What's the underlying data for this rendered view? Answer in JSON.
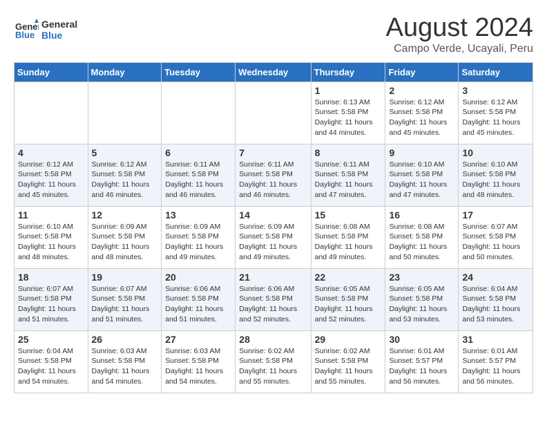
{
  "header": {
    "logo_line1": "General",
    "logo_line2": "Blue",
    "title": "August 2024",
    "subtitle": "Campo Verde, Ucayali, Peru"
  },
  "weekdays": [
    "Sunday",
    "Monday",
    "Tuesday",
    "Wednesday",
    "Thursday",
    "Friday",
    "Saturday"
  ],
  "weeks": [
    [
      {
        "day": "",
        "info": ""
      },
      {
        "day": "",
        "info": ""
      },
      {
        "day": "",
        "info": ""
      },
      {
        "day": "",
        "info": ""
      },
      {
        "day": "1",
        "info": "Sunrise: 6:13 AM\nSunset: 5:58 PM\nDaylight: 11 hours\nand 44 minutes."
      },
      {
        "day": "2",
        "info": "Sunrise: 6:12 AM\nSunset: 5:58 PM\nDaylight: 11 hours\nand 45 minutes."
      },
      {
        "day": "3",
        "info": "Sunrise: 6:12 AM\nSunset: 5:58 PM\nDaylight: 11 hours\nand 45 minutes."
      }
    ],
    [
      {
        "day": "4",
        "info": "Sunrise: 6:12 AM\nSunset: 5:58 PM\nDaylight: 11 hours\nand 45 minutes."
      },
      {
        "day": "5",
        "info": "Sunrise: 6:12 AM\nSunset: 5:58 PM\nDaylight: 11 hours\nand 46 minutes."
      },
      {
        "day": "6",
        "info": "Sunrise: 6:11 AM\nSunset: 5:58 PM\nDaylight: 11 hours\nand 46 minutes."
      },
      {
        "day": "7",
        "info": "Sunrise: 6:11 AM\nSunset: 5:58 PM\nDaylight: 11 hours\nand 46 minutes."
      },
      {
        "day": "8",
        "info": "Sunrise: 6:11 AM\nSunset: 5:58 PM\nDaylight: 11 hours\nand 47 minutes."
      },
      {
        "day": "9",
        "info": "Sunrise: 6:10 AM\nSunset: 5:58 PM\nDaylight: 11 hours\nand 47 minutes."
      },
      {
        "day": "10",
        "info": "Sunrise: 6:10 AM\nSunset: 5:58 PM\nDaylight: 11 hours\nand 48 minutes."
      }
    ],
    [
      {
        "day": "11",
        "info": "Sunrise: 6:10 AM\nSunset: 5:58 PM\nDaylight: 11 hours\nand 48 minutes."
      },
      {
        "day": "12",
        "info": "Sunrise: 6:09 AM\nSunset: 5:58 PM\nDaylight: 11 hours\nand 48 minutes."
      },
      {
        "day": "13",
        "info": "Sunrise: 6:09 AM\nSunset: 5:58 PM\nDaylight: 11 hours\nand 49 minutes."
      },
      {
        "day": "14",
        "info": "Sunrise: 6:09 AM\nSunset: 5:58 PM\nDaylight: 11 hours\nand 49 minutes."
      },
      {
        "day": "15",
        "info": "Sunrise: 6:08 AM\nSunset: 5:58 PM\nDaylight: 11 hours\nand 49 minutes."
      },
      {
        "day": "16",
        "info": "Sunrise: 6:08 AM\nSunset: 5:58 PM\nDaylight: 11 hours\nand 50 minutes."
      },
      {
        "day": "17",
        "info": "Sunrise: 6:07 AM\nSunset: 5:58 PM\nDaylight: 11 hours\nand 50 minutes."
      }
    ],
    [
      {
        "day": "18",
        "info": "Sunrise: 6:07 AM\nSunset: 5:58 PM\nDaylight: 11 hours\nand 51 minutes."
      },
      {
        "day": "19",
        "info": "Sunrise: 6:07 AM\nSunset: 5:58 PM\nDaylight: 11 hours\nand 51 minutes."
      },
      {
        "day": "20",
        "info": "Sunrise: 6:06 AM\nSunset: 5:58 PM\nDaylight: 11 hours\nand 51 minutes."
      },
      {
        "day": "21",
        "info": "Sunrise: 6:06 AM\nSunset: 5:58 PM\nDaylight: 11 hours\nand 52 minutes."
      },
      {
        "day": "22",
        "info": "Sunrise: 6:05 AM\nSunset: 5:58 PM\nDaylight: 11 hours\nand 52 minutes."
      },
      {
        "day": "23",
        "info": "Sunrise: 6:05 AM\nSunset: 5:58 PM\nDaylight: 11 hours\nand 53 minutes."
      },
      {
        "day": "24",
        "info": "Sunrise: 6:04 AM\nSunset: 5:58 PM\nDaylight: 11 hours\nand 53 minutes."
      }
    ],
    [
      {
        "day": "25",
        "info": "Sunrise: 6:04 AM\nSunset: 5:58 PM\nDaylight: 11 hours\nand 54 minutes."
      },
      {
        "day": "26",
        "info": "Sunrise: 6:03 AM\nSunset: 5:58 PM\nDaylight: 11 hours\nand 54 minutes."
      },
      {
        "day": "27",
        "info": "Sunrise: 6:03 AM\nSunset: 5:58 PM\nDaylight: 11 hours\nand 54 minutes."
      },
      {
        "day": "28",
        "info": "Sunrise: 6:02 AM\nSunset: 5:58 PM\nDaylight: 11 hours\nand 55 minutes."
      },
      {
        "day": "29",
        "info": "Sunrise: 6:02 AM\nSunset: 5:58 PM\nDaylight: 11 hours\nand 55 minutes."
      },
      {
        "day": "30",
        "info": "Sunrise: 6:01 AM\nSunset: 5:57 PM\nDaylight: 11 hours\nand 56 minutes."
      },
      {
        "day": "31",
        "info": "Sunrise: 6:01 AM\nSunset: 5:57 PM\nDaylight: 11 hours\nand 56 minutes."
      }
    ]
  ]
}
